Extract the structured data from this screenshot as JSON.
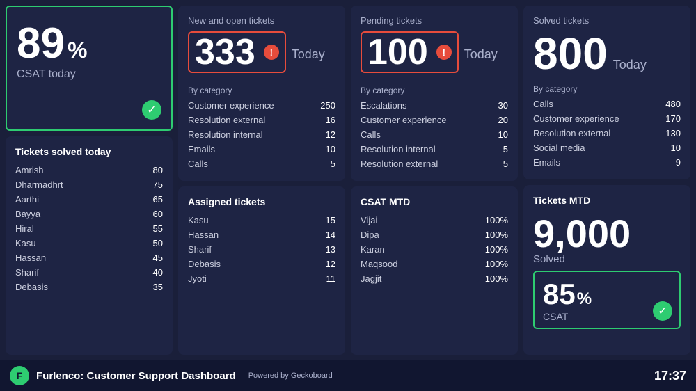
{
  "footer": {
    "logo_letter": "F",
    "title": "Furlenco: Customer Support Dashboard",
    "subtitle": "Powered by Geckoboard",
    "time": "17:37"
  },
  "csat_today": {
    "panel_title": "",
    "value": "89",
    "percent": "%",
    "label": "CSAT today"
  },
  "tickets_solved_today": {
    "title": "Tickets solved today",
    "items": [
      {
        "name": "Amrish",
        "value": "80"
      },
      {
        "name": "Dharmadhrt",
        "value": "75"
      },
      {
        "name": "Aarthi",
        "value": "65"
      },
      {
        "name": "Bayya",
        "value": "60"
      },
      {
        "name": "Hiral",
        "value": "55"
      },
      {
        "name": "Kasu",
        "value": "50"
      },
      {
        "name": "Hassan",
        "value": "45"
      },
      {
        "name": "Sharif",
        "value": "40"
      },
      {
        "name": "Debasis",
        "value": "35"
      }
    ]
  },
  "new_open_tickets": {
    "title": "New and open tickets",
    "value": "333",
    "today_label": "Today",
    "by_category_label": "By category",
    "items": [
      {
        "name": "Customer experience",
        "value": "250"
      },
      {
        "name": "Resolution external",
        "value": "16"
      },
      {
        "name": "Resolution internal",
        "value": "12"
      },
      {
        "name": "Emails",
        "value": "10"
      },
      {
        "name": "Calls",
        "value": "5"
      }
    ]
  },
  "assigned_tickets": {
    "title": "Assigned tickets",
    "items": [
      {
        "name": "Kasu",
        "value": "15"
      },
      {
        "name": "Hassan",
        "value": "14"
      },
      {
        "name": "Sharif",
        "value": "13"
      },
      {
        "name": "Debasis",
        "value": "12"
      },
      {
        "name": "Jyoti",
        "value": "11"
      }
    ]
  },
  "pending_tickets": {
    "title": "Pending tickets",
    "value": "100",
    "today_label": "Today",
    "by_category_label": "By category",
    "items": [
      {
        "name": "Escalations",
        "value": "30"
      },
      {
        "name": "Customer experience",
        "value": "20"
      },
      {
        "name": "Calls",
        "value": "10"
      },
      {
        "name": "Resolution internal",
        "value": "5"
      },
      {
        "name": "Resolution external",
        "value": "5"
      }
    ]
  },
  "csat_mtd": {
    "title": "CSAT MTD",
    "items": [
      {
        "name": "Vijai",
        "value": "100%"
      },
      {
        "name": "Dipa",
        "value": "100%"
      },
      {
        "name": "Karan",
        "value": "100%"
      },
      {
        "name": "Maqsood",
        "value": "100%"
      },
      {
        "name": "Jagjit",
        "value": "100%"
      }
    ]
  },
  "solved_tickets": {
    "title": "Solved tickets",
    "value": "800",
    "today_label": "Today",
    "by_category_label": "By category",
    "items": [
      {
        "name": "Calls",
        "value": "480"
      },
      {
        "name": "Customer experience",
        "value": "170"
      },
      {
        "name": "Resolution external",
        "value": "130"
      },
      {
        "name": "Social media",
        "value": "10"
      },
      {
        "name": "Emails",
        "value": "9"
      }
    ]
  },
  "tickets_mtd": {
    "title": "Tickets MTD",
    "value": "9,000",
    "solved_label": "Solved",
    "csat_value": "85",
    "csat_percent": "%",
    "csat_label": "CSAT"
  }
}
